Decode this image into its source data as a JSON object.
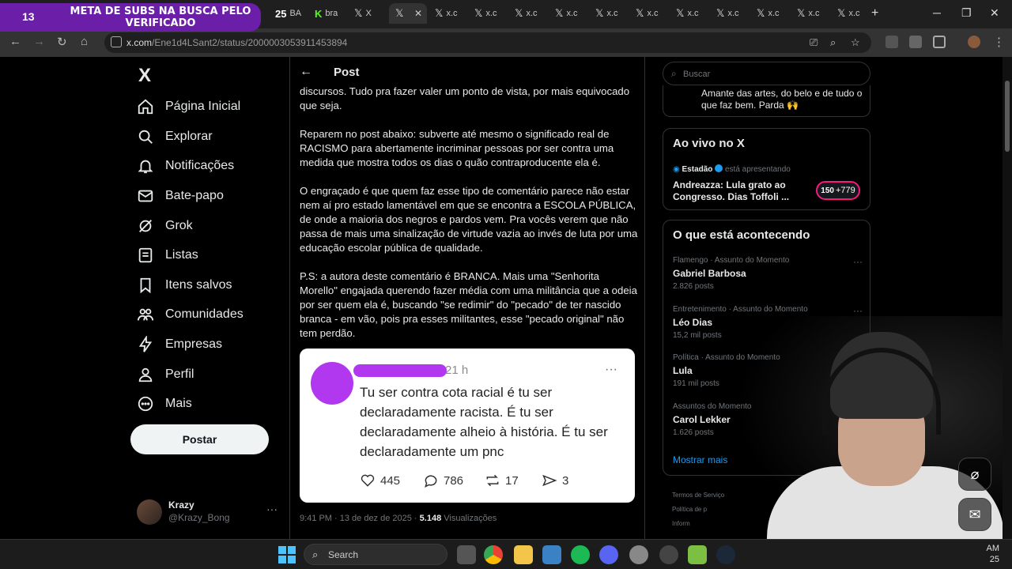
{
  "overlay": {
    "count": "13",
    "text": "META DE SUBS NA BUSCA PELO VERIFICADO"
  },
  "tabs": [
    {
      "label": "BA",
      "icon": "tab-favicon-icon"
    },
    {
      "label": "bra",
      "icon": "kick-icon"
    },
    {
      "label": "X",
      "icon": "x-logo-icon"
    },
    {
      "label": "",
      "icon": "x-logo-icon",
      "active": true
    },
    {
      "label": "x.c",
      "icon": "x-logo-icon"
    },
    {
      "label": "x.c",
      "icon": "x-logo-icon"
    },
    {
      "label": "x.c",
      "icon": "x-logo-icon"
    },
    {
      "label": "x.c",
      "icon": "x-logo-icon"
    },
    {
      "label": "x.c",
      "icon": "x-logo-icon"
    },
    {
      "label": "x.c",
      "icon": "x-logo-icon"
    },
    {
      "label": "x.c",
      "icon": "x-logo-icon"
    },
    {
      "label": "x.c",
      "icon": "x-logo-icon"
    },
    {
      "label": "x.c",
      "icon": "x-logo-icon"
    },
    {
      "label": "x.c",
      "icon": "x-logo-icon"
    },
    {
      "label": "x.c",
      "icon": "x-logo-icon"
    }
  ],
  "tab_prefix": {
    "wi": "Wi",
    "badge": "25"
  },
  "address": {
    "host": "x.com",
    "path": "/Ene1d4LSant2/status/2000003053911453894"
  },
  "nav": {
    "logo": "X",
    "items": [
      {
        "label": "Página Inicial",
        "icon": "home-icon"
      },
      {
        "label": "Explorar",
        "icon": "search-icon"
      },
      {
        "label": "Notificações",
        "icon": "bell-icon"
      },
      {
        "label": "Bate-papo",
        "icon": "mail-icon"
      },
      {
        "label": "Grok",
        "icon": "grok-icon"
      },
      {
        "label": "Listas",
        "icon": "list-icon"
      },
      {
        "label": "Itens salvos",
        "icon": "bookmark-icon"
      },
      {
        "label": "Comunidades",
        "icon": "people-icon"
      },
      {
        "label": "Empresas",
        "icon": "lightning-icon"
      },
      {
        "label": "Perfil",
        "icon": "person-icon"
      },
      {
        "label": "Mais",
        "icon": "more-circle-icon"
      }
    ],
    "post_label": "Postar",
    "account": {
      "name": "Krazy",
      "handle": "@Krazy_Bong"
    }
  },
  "post": {
    "header": "Post",
    "paragraphs": [
      "discursos. Tudo pra fazer valer um ponto de vista, por mais equivocado que seja.",
      "Reparem no post abaixo: subverte até mesmo o significado real de RACISMO para abertamente incriminar pessoas por ser contra uma medida que mostra todos os dias o quão contraproducente ela é.",
      "O engraçado é que quem faz esse tipo de comentário parece não estar nem aí pro estado lamentável em que se encontra a ESCOLA PÚBLICA, de onde a maioria dos negros e pardos vem. Pra vocês verem que não passa de mais uma sinalização de virtude vazia ao invés de luta por uma educação escolar pública de qualidade.",
      "P.S: a autora deste comentário é BRANCA. Mais uma \"Senhorita Morello\" engajada querendo fazer média com uma militância que a odeia por ser quem ela é, buscando \"se redimir\" do \"pecado\" de ter nascido branca - em vão, pois pra esses militantes, esse \"pecado original\" não tem perdão."
    ],
    "quoted": {
      "time": "21 h",
      "text": "Tu ser contra cota racial é tu ser declaradamente racista. É tu ser declaradamente alheio à história. É tu ser declaradamente um pnc",
      "likes": "445",
      "replies": "786",
      "reposts": "17",
      "shares": "3"
    },
    "meta": {
      "time": "9:41 PM · 13 de dez de 2025 · ",
      "views": "5.148",
      "views_label": " Visualizações"
    }
  },
  "right": {
    "search_placeholder": "Buscar",
    "bio": "Amante das artes, do belo e de tudo o que faz bem. Parda 🙌",
    "live": {
      "title": "Ao vivo no X",
      "host": "Estadão",
      "host_suffix": "está apresentando",
      "stream_title": "Andreazza: Lula grato ao Congresso. Dias Toffoli ...",
      "listeners_badge": "150",
      "listeners": "+779"
    },
    "trends": {
      "title": "O que está acontecendo",
      "items": [
        {
          "context": "Flamengo · Assunto do Momento",
          "name": "Gabriel Barbosa",
          "count": "2.826 posts"
        },
        {
          "context": "Entretenimento · Assunto do Momento",
          "name": "Léo Dias",
          "count": "15,2 mil posts"
        },
        {
          "context": "Política · Assunto do Momento",
          "name": "Lula",
          "count": "191 mil posts"
        },
        {
          "context": "Assuntos do Momento",
          "name": "Carol Lekker",
          "count": "1.626 posts"
        }
      ],
      "show_more": "Mostrar mais"
    },
    "footer": [
      "Termos de Serviço",
      "Política de p",
      "Inform"
    ]
  },
  "taskbar": {
    "search_label": "Search",
    "clock_time": "AM",
    "clock_date": "25"
  },
  "colors": {
    "accent": "#1d9bf0",
    "overlay": "#6b1fa8",
    "redaction": "#b238f0",
    "live_border": "#f91880"
  }
}
